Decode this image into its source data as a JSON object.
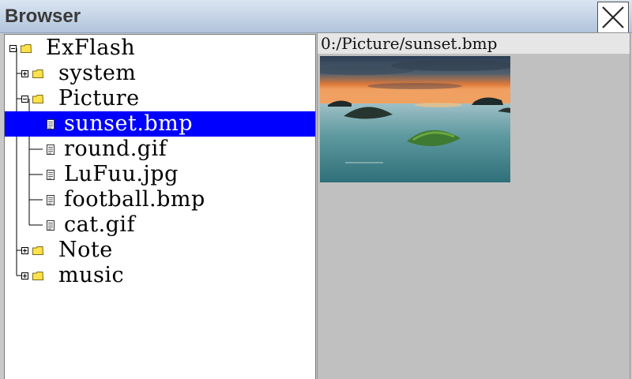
{
  "window": {
    "title": "Browser"
  },
  "tree": {
    "nodes": [
      {
        "label": "ExFlash",
        "type": "folder",
        "expanded": true,
        "level": 0
      },
      {
        "label": "system",
        "type": "folder",
        "expanded": false,
        "level": 1
      },
      {
        "label": "Picture",
        "type": "folder",
        "expanded": true,
        "level": 1
      },
      {
        "label": "sunset.bmp",
        "type": "file",
        "level": 2,
        "selected": true
      },
      {
        "label": "round.gif",
        "type": "file",
        "level": 2
      },
      {
        "label": "LuFuu.jpg",
        "type": "file",
        "level": 2
      },
      {
        "label": "football.bmp",
        "type": "file",
        "level": 2
      },
      {
        "label": "cat.gif",
        "type": "file",
        "level": 2
      },
      {
        "label": "Note",
        "type": "folder",
        "expanded": false,
        "level": 1
      },
      {
        "label": "music",
        "type": "folder",
        "expanded": false,
        "level": 1
      }
    ]
  },
  "preview": {
    "path": "0:/Picture/sunset.bmp",
    "image_alt": "sunset seascape thumbnail"
  },
  "colors": {
    "selection": "#0000ff",
    "selection_text": "#ffffff",
    "folder_fill": "#ffe24a",
    "folder_stroke": "#7a6a1a"
  }
}
